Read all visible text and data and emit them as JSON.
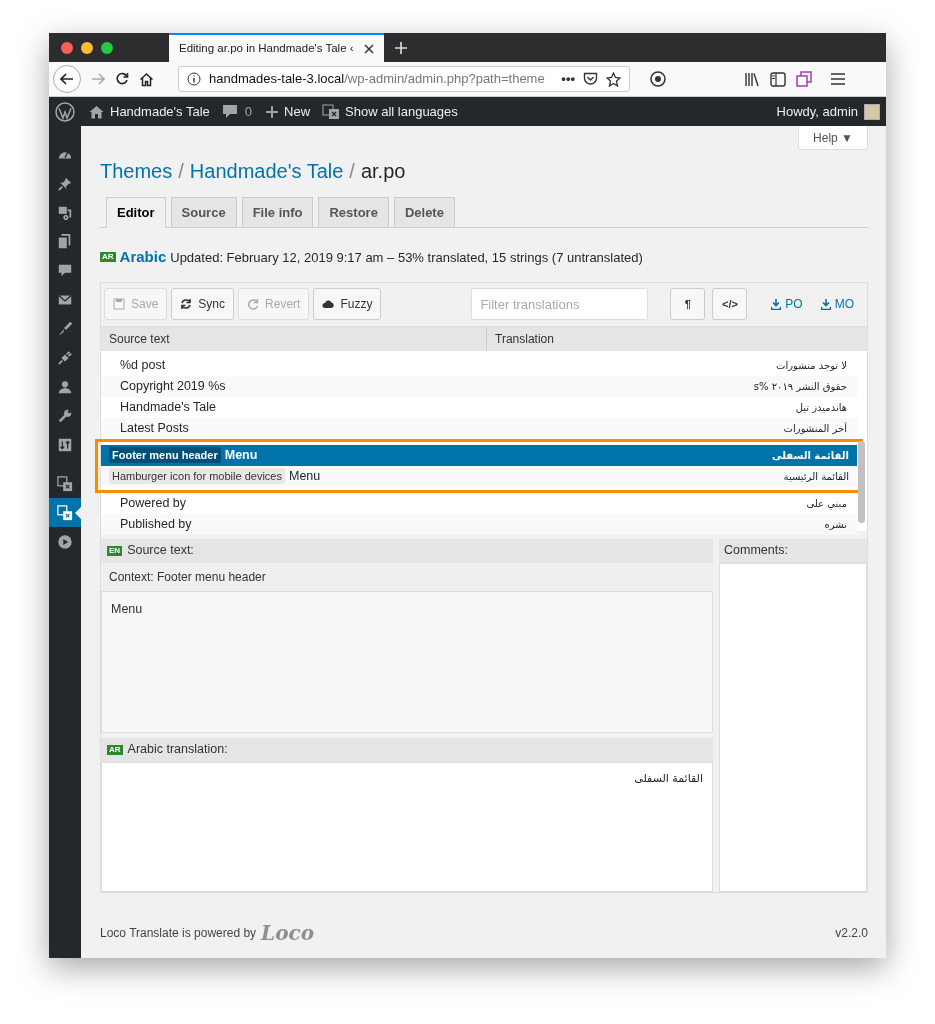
{
  "browser": {
    "tab_title": "Editing ar.po in Handmade's Tale ‹",
    "url_host": "handmades-tale-3.local",
    "url_path": "/wp-admin/admin.php?path=theme",
    "forward_disabled": true,
    "page_actions": "•••"
  },
  "admin_bar": {
    "site": "Handmade's Tale",
    "comments": "0",
    "new": "New",
    "languages": "Show all languages",
    "greeting": "Howdy, admin"
  },
  "sidebar": {
    "items": [
      {
        "selected": false
      },
      {
        "selected": false
      },
      {
        "selected": false
      },
      {
        "selected": false
      },
      {
        "selected": false
      },
      {
        "selected": false
      },
      {
        "selected": false
      },
      {
        "selected": false
      },
      {
        "selected": false
      },
      {
        "selected": false
      },
      {
        "selected": false
      },
      {
        "selected": false
      },
      {
        "selected": true
      },
      {
        "selected": false
      }
    ]
  },
  "help": "Help ▼",
  "breadcrumb_separator": "/",
  "breadcrumb": [
    {
      "label": "Themes",
      "link": true
    },
    {
      "label": "Handmade's Tale",
      "link": true
    },
    {
      "label": "ar.po",
      "link": false
    }
  ],
  "tabs": [
    {
      "label": "Editor",
      "selected": true
    },
    {
      "label": "Source",
      "selected": false
    },
    {
      "label": "File info",
      "selected": false
    },
    {
      "label": "Restore",
      "selected": false
    },
    {
      "label": "Delete",
      "selected": false
    }
  ],
  "locale": {
    "code": "AR",
    "name": "Arabic",
    "summary": "Updated: February 12, 2019 9:17 am – 53% translated, 15 strings (7 untranslated)"
  },
  "toolbar": {
    "buttons": [
      {
        "label": "Save",
        "disabled": true
      },
      {
        "label": "Sync",
        "disabled": false
      },
      {
        "label": "Revert",
        "disabled": true
      },
      {
        "label": "Fuzzy",
        "disabled": false
      }
    ],
    "filter": {
      "placeholder": "Filter translations"
    },
    "toggles": [
      "¶",
      "</>"
    ],
    "downloads": [
      "PO",
      "MO"
    ]
  },
  "table": {
    "columns": [
      "Source text",
      "Translation"
    ],
    "rows": [
      {
        "source": "%d post",
        "translation": "لا توجد منشورات",
        "selected": false,
        "annotated": false
      },
      {
        "source": "Copyright 2019 %s",
        "translation": "حقوق النشر ٢٠١٩ %s",
        "selected": false,
        "annotated": false
      },
      {
        "source": "Handmade's Tale",
        "translation": "هاندميدز تيل",
        "selected": false,
        "annotated": false
      },
      {
        "source": "Latest Posts",
        "translation": "أخر المنشورات",
        "selected": false,
        "annotated": false
      },
      {
        "context": "Footer menu header",
        "source": "Menu",
        "translation": "القائمة السفلى",
        "selected": true,
        "annotated": true
      },
      {
        "context": "Hamburger icon for mobile devices",
        "source": "Menu",
        "translation": "القائمة الرئيسية",
        "selected": false,
        "annotated": true
      },
      {
        "source": "Powered by",
        "translation": "مبني على",
        "selected": false,
        "annotated": false
      },
      {
        "source": "Published by",
        "translation": "نشره",
        "selected": false,
        "annotated": false
      }
    ]
  },
  "source_pane": {
    "code": "EN",
    "title": "Source text:",
    "context": "Context: Footer menu header",
    "text": "Menu"
  },
  "translation_pane": {
    "code": "AR",
    "title": "Arabic translation:",
    "value": "القائمة السفلى"
  },
  "comments_pane": {
    "title": "Comments:"
  },
  "footer": {
    "text": "Loco Translate is powered by",
    "logo": "Loco",
    "version": "v2.2.0"
  }
}
